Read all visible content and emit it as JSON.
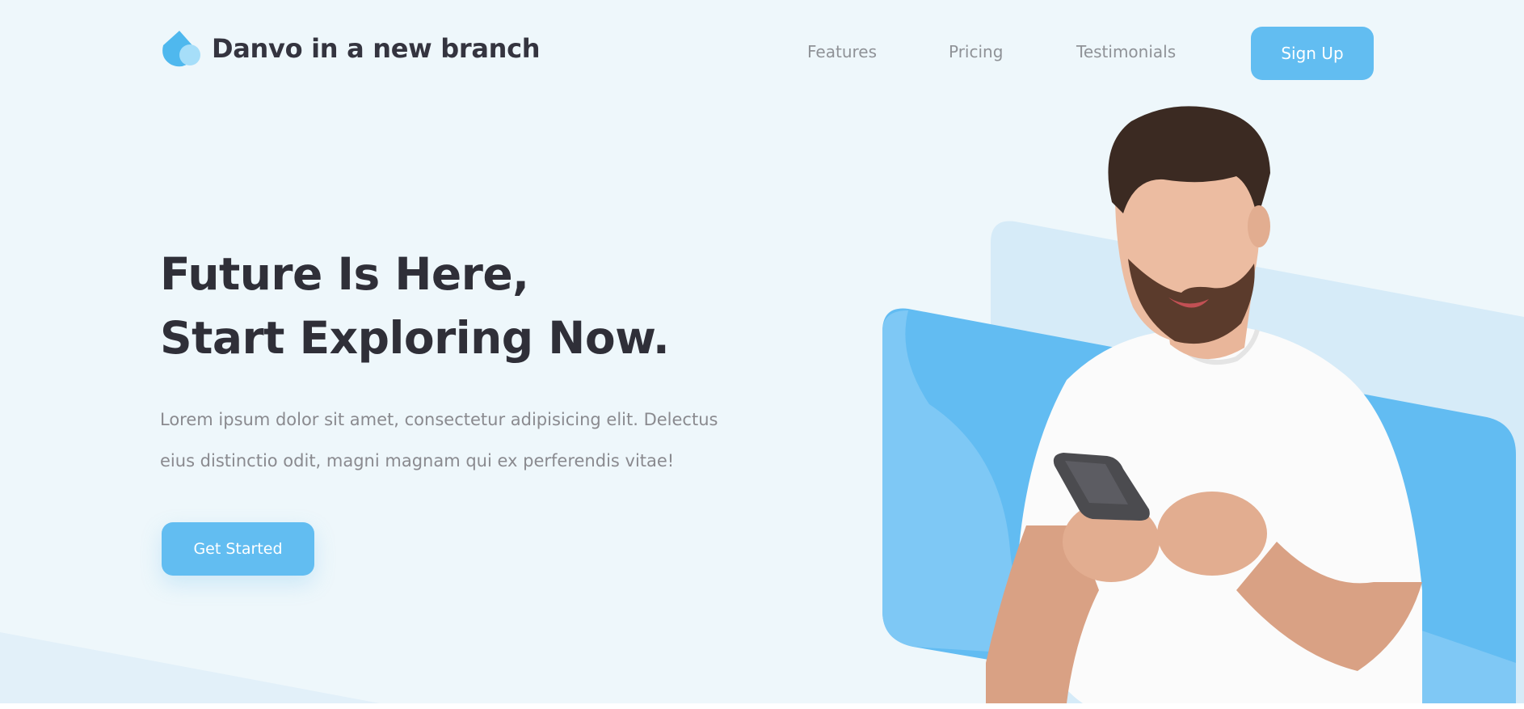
{
  "header": {
    "brand_name": "Danvo in a new branch",
    "nav": [
      {
        "label": "Features"
      },
      {
        "label": "Pricing"
      },
      {
        "label": "Testimonials"
      }
    ],
    "signup_label": "Sign Up"
  },
  "hero": {
    "title_line1": "Future Is Here,",
    "title_line2": "Start Exploring Now.",
    "description_line1": "Lorem ipsum dolor sit amet, consectetur adipisicing elit. Delectus",
    "description_line2": "eius distinctio odit, magni magnam qui ex perferendis vitae!",
    "cta_label": "Get Started"
  },
  "colors": {
    "page_background": "#eef7fb",
    "accent": "#62bdf1",
    "accent_light": "#d6ebf8",
    "heading": "#2f2f38",
    "body_text": "#8a8a8f",
    "nav_text": "#8f9297"
  }
}
